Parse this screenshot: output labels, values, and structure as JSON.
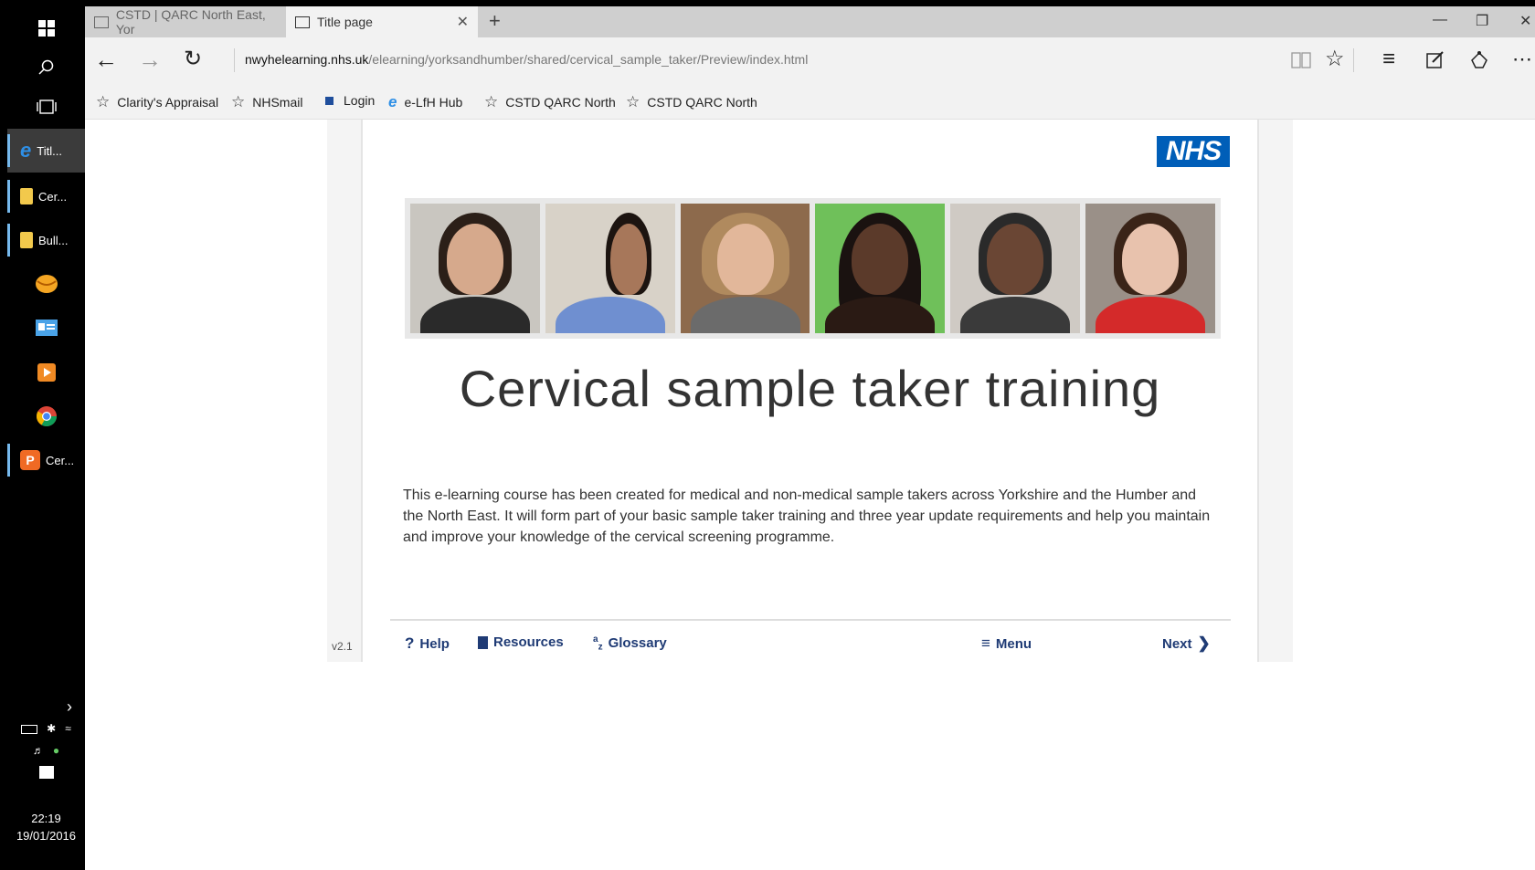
{
  "taskbar": {
    "apps": [
      {
        "label": "Titl...",
        "icon": "edge-icon"
      },
      {
        "label": "Cer...",
        "icon": "folder-icon"
      },
      {
        "label": "Bull...",
        "icon": "folder-icon"
      },
      {
        "label": "Cer...",
        "icon": "powerpoint-icon"
      }
    ],
    "clock": {
      "time": "22:19",
      "date": "19/01/2016"
    }
  },
  "browser": {
    "tabs": [
      {
        "label": "CSTD | QARC North East, Yor"
      },
      {
        "label": "Title page"
      }
    ],
    "address": {
      "host": "nwyhelearning.nhs.uk",
      "path": "/elearning/yorksandhumber/shared/cervical_sample_taker/Preview/index.html"
    },
    "favorites": [
      {
        "label": "Clarity's Appraisal"
      },
      {
        "label": "NHSmail"
      },
      {
        "label": "Login"
      },
      {
        "label": "e-LfH Hub"
      },
      {
        "label": "CSTD  QARC North"
      },
      {
        "label": "CSTD  QARC North"
      }
    ]
  },
  "page": {
    "logo": "NHS",
    "title": "Cervical sample taker training",
    "intro": "This e-learning course has been created for medical and non-medical sample takers across Yorkshire and the Humber and the North East. It will form part of your basic sample taker training and three year update requirements and help you maintain and improve your knowledge of the cervical screening programme.",
    "version": "v2.1",
    "footer": {
      "help": "Help",
      "resources": "Resources",
      "glossary": "Glossary",
      "menu": "Menu",
      "next": "Next"
    }
  }
}
